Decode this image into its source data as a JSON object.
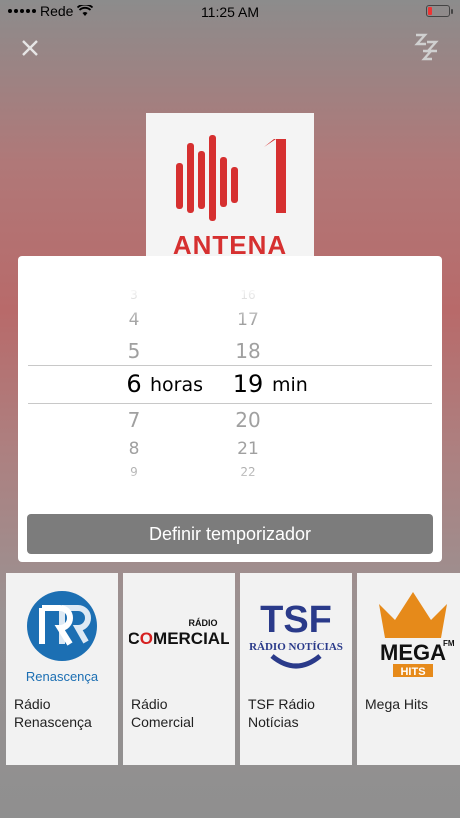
{
  "status_bar": {
    "carrier": "Rede",
    "time": "11:25 AM"
  },
  "header": {
    "close_icon": "close-icon",
    "sleep_icon": "sleep-zzz-icon",
    "sleep_glyph": "ZZZ"
  },
  "current_station": {
    "logo_text_number": "1",
    "logo_text_name": "ANTENA"
  },
  "timer_picker": {
    "hours": {
      "items": [
        "3",
        "4",
        "5",
        "6",
        "7",
        "8",
        "9"
      ],
      "selected": "6",
      "unit": "horas"
    },
    "minutes": {
      "items": [
        "16",
        "17",
        "18",
        "19",
        "20",
        "21",
        "22"
      ],
      "selected": "19",
      "unit": "min"
    },
    "button_label": "Definir temporizador"
  },
  "stations": [
    {
      "name": "Rádio Renascença",
      "logo_label": "Renascença"
    },
    {
      "name": "Rádio Comercial",
      "logo_label": "RÁDIO COMERCIAL"
    },
    {
      "name": "TSF Rádio Notícias",
      "logo_label": "RÁDIO NOTÍCIAS"
    },
    {
      "name": "Mega Hits",
      "logo_label": "MEGA HITS"
    }
  ],
  "colors": {
    "accent_red": "#d63030",
    "button_gray": "#7c7c7c",
    "overlay_white": "#ffffff"
  }
}
